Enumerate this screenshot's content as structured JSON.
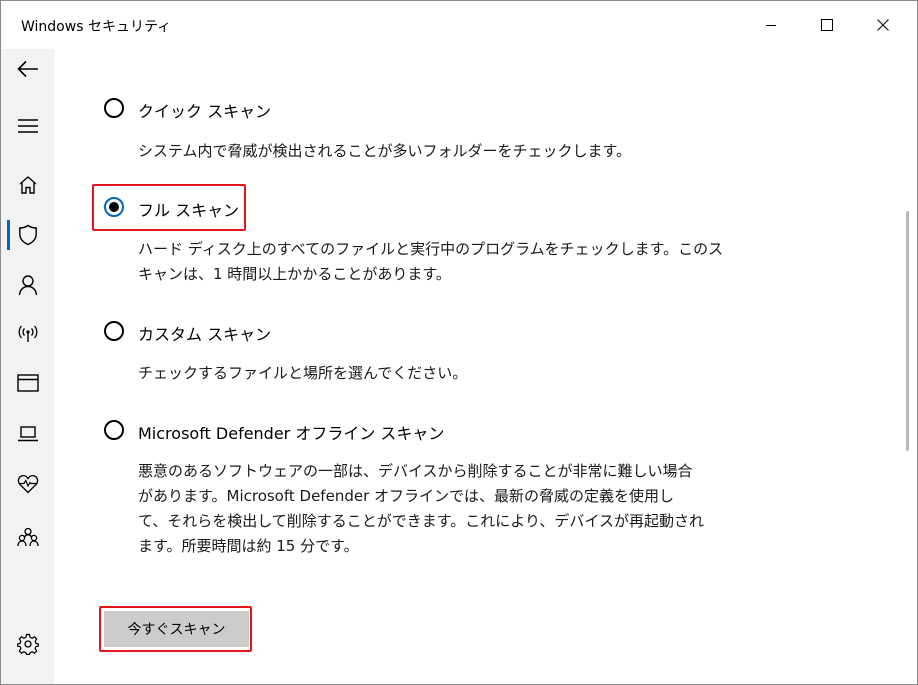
{
  "window": {
    "title": "Windows セキュリティ"
  },
  "titlebar_buttons": {
    "minimize": "minimize-icon",
    "maximize": "maximize-icon",
    "close": "close-icon"
  },
  "sidebar": {
    "items": [
      {
        "name": "back-icon"
      },
      {
        "name": "menu-icon"
      },
      {
        "name": "home-icon"
      },
      {
        "name": "shield-icon",
        "selected": true
      },
      {
        "name": "account-icon"
      },
      {
        "name": "network-icon"
      },
      {
        "name": "app-browser-icon"
      },
      {
        "name": "device-security-icon"
      },
      {
        "name": "health-icon"
      },
      {
        "name": "family-icon"
      },
      {
        "name": "settings-icon"
      }
    ]
  },
  "scan_options": [
    {
      "label": "クイック スキャン",
      "selected": false,
      "description": [
        "システム内で脅威が検出されることが多いフォルダーをチェックします。"
      ]
    },
    {
      "label": "フル スキャン",
      "selected": true,
      "description": [
        "ハード ディスク上のすべてのファイルと実行中のプログラムをチェックします。このス",
        "キャンは、1 時間以上かかることがあります。"
      ]
    },
    {
      "label": "カスタム スキャン",
      "selected": false,
      "description": [
        "チェックするファイルと場所を選んでください。"
      ]
    },
    {
      "label": "Microsoft Defender オフライン スキャン",
      "selected": false,
      "description": [
        "悪意のあるソフトウェアの一部は、デバイスから削除することが非常に難しい場合",
        "があります。Microsoft Defender オフラインでは、最新の脅威の定義を使用し",
        "て、それらを検出して削除することができます。これにより、デバイスが再起動され",
        "ます。所要時間は約 15 分です。"
      ]
    }
  ],
  "scan_button": {
    "label": "今すぐスキャン"
  },
  "colors": {
    "accent": "#0067c0",
    "highlight": "#e8141c",
    "button": "#cccccc",
    "sidebar": "#f2f2f2"
  }
}
